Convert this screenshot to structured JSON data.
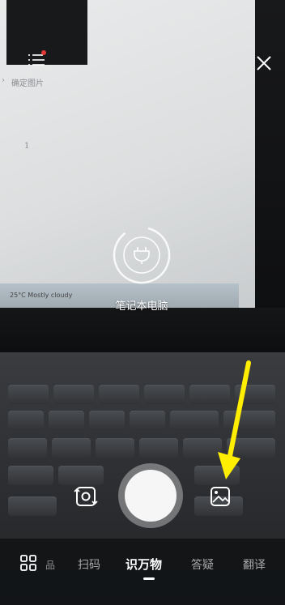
{
  "camera": {
    "detected_object_label": "笔记本电脑",
    "close_icon": "close-icon",
    "menu_icon": "menu-list-icon",
    "notification_dot_color": "#e53935"
  },
  "screen": {
    "doc_heading": "确定图片",
    "doc_arrow": "›",
    "doc_mark": "1",
    "taskbar_weather": "25°C Mostly cloudy"
  },
  "controls": {
    "switch_camera_icon": "switch-camera-icon",
    "shutter_icon": "shutter-button",
    "gallery_icon": "gallery-icon",
    "annotation_arrow_color": "#ffee00"
  },
  "modes": {
    "items": [
      {
        "label": "品"
      },
      {
        "label": "扫码"
      },
      {
        "label": "识万物"
      },
      {
        "label": "答疑"
      },
      {
        "label": "翻译"
      }
    ],
    "active_index": 2
  }
}
